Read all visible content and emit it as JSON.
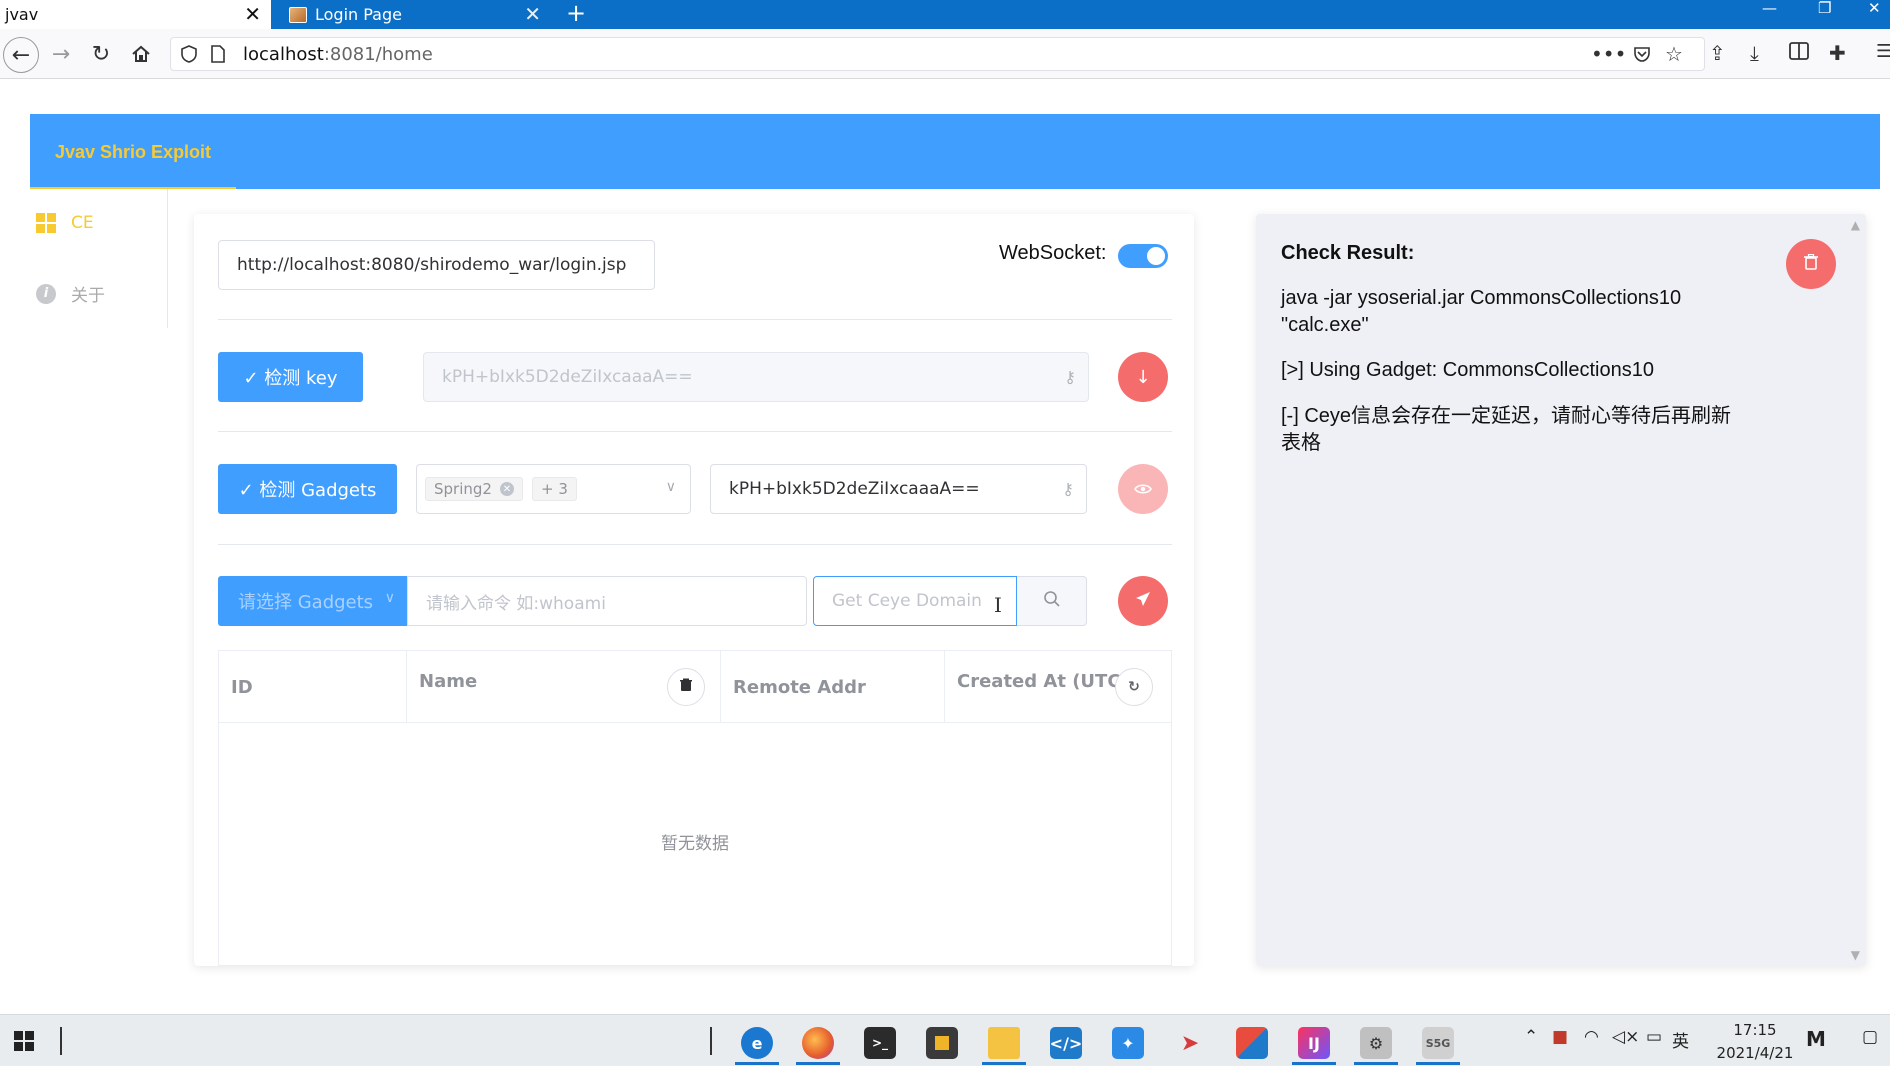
{
  "browser": {
    "tabs": [
      {
        "title": "jvav",
        "active": true
      },
      {
        "title": "Login Page",
        "active": false
      }
    ],
    "new_tab": "+",
    "close_glyph": "✕",
    "window_controls": [
      "—",
      "❐",
      "✕"
    ],
    "url_host": "localhost",
    "url_rest": ":8081/home",
    "toolbar_icons": [
      "pocket-icon",
      "star-icon",
      "library-icon",
      "download-icon",
      "sidebar-icon",
      "extensions-icon",
      "menu-icon"
    ]
  },
  "app": {
    "title": "Jvav Shrio Exploit",
    "accent": "#409eff",
    "brand_yellow": "#f7ca32",
    "danger": "#f56c6c"
  },
  "sidebar": {
    "items": [
      {
        "label": "CE",
        "icon": "grid-icon",
        "active": true
      },
      {
        "label": "关于",
        "icon": "info-icon",
        "active": false
      }
    ]
  },
  "main": {
    "target_url": "http://localhost:8080/shirodemo_war/login.jsp",
    "websocket_label": "WebSocket:",
    "websocket_on": true,
    "check_key_label": "✓ 检测 key",
    "key_placeholder": "kPH+bIxk5D2deZiIxcaaaA==",
    "check_gadgets_label": "✓ 检测 Gadgets",
    "gadgets_selected": "Spring2",
    "gadgets_more": "+ 3",
    "key_value": "kPH+bIxk5D2deZiIxcaaaA==",
    "select_gadgets_label": "请选择 Gadgets",
    "command_placeholder": "请输入命令 如:whoami",
    "ceye_placeholder": "Get Ceye Domain",
    "table": {
      "columns": [
        "ID",
        "Name",
        "Remote Addr",
        "Created At (UTC)"
      ],
      "rows": [],
      "empty_text": "暂无数据"
    }
  },
  "result": {
    "title": "Check Result:",
    "lines": [
      "java -jar ysoserial.jar CommonsCollections10 \"calc.exe\"",
      "[>] Using Gadget: CommonsCollections10",
      "[-] Ceye信息会存在一定延迟，请耐心等待后再刷新表格"
    ]
  },
  "taskbar": {
    "time": "17:15",
    "date": "2021/4/21",
    "ime": "英",
    "apps": [
      "edge-icon",
      "firefox-icon",
      "terminal-icon",
      "sublime-icon",
      "explorer-icon",
      "vscode-icon",
      "tool-icon",
      "paper-plane-icon",
      "app-icon",
      "intellij-icon",
      "burp-icon",
      "remote-desktop-icon"
    ]
  }
}
